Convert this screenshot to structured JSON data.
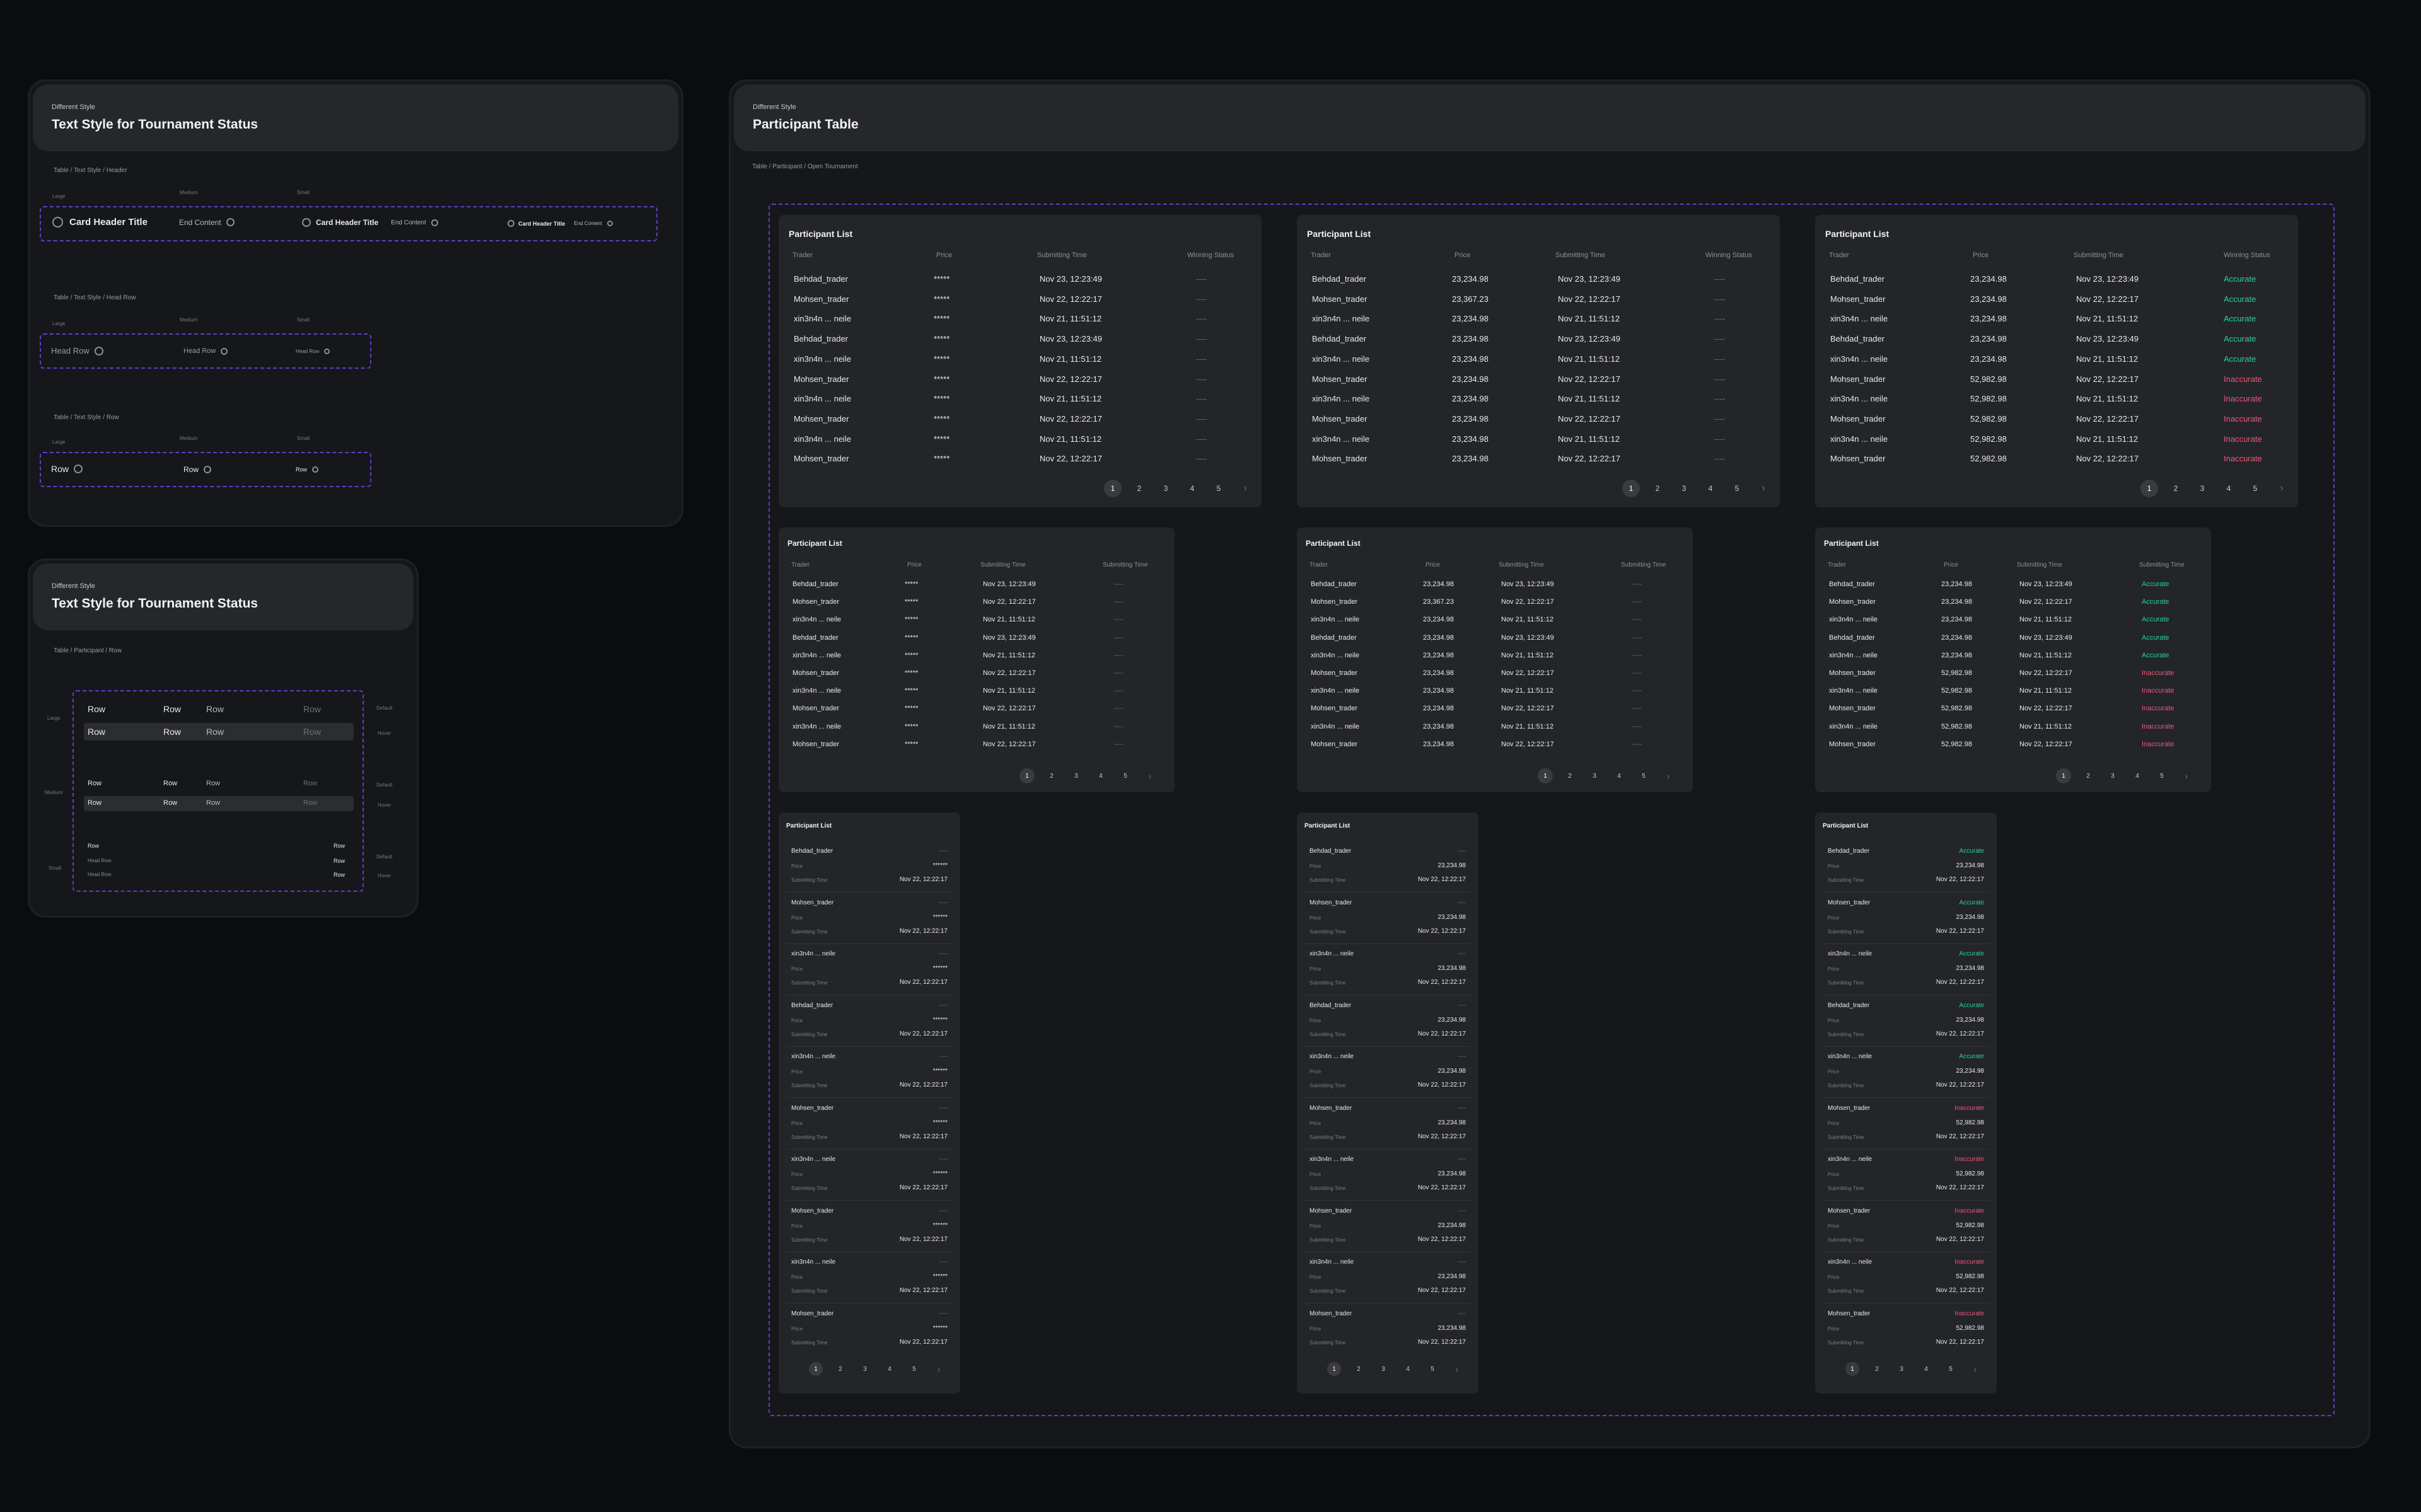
{
  "left_panel_1": {
    "tag": "Different Style",
    "title": "Text Style for Tournament Status",
    "sections": [
      {
        "label": "Table / Text Style / Header"
      },
      {
        "label": "Table / Text Style / Head Row"
      },
      {
        "label": "Table / Text Style / Row"
      }
    ],
    "sizes": {
      "large": "Large",
      "medium": "Medium",
      "small": "Small"
    },
    "header_items": {
      "title": "Card Header Title",
      "end": "End Content"
    },
    "head_row_label": "Head Row",
    "row_label": "Row"
  },
  "left_panel_2": {
    "tag": "Different Style",
    "title": "Text Style for Tournament Status",
    "section": "Table / Participant / Row",
    "size_labels": {
      "large": "Large",
      "medium": "Medium",
      "small": "Small"
    },
    "state_labels": {
      "default": "Default",
      "hover": "Hover"
    },
    "row_label": "Row",
    "head_row_label": "Head Row"
  },
  "right_panel": {
    "tag": "Different Style",
    "title": "Participant Table",
    "breadcrumb": "Table / Participant / Open Tournament"
  },
  "card_title": "Participant List",
  "columns": {
    "trader": "Trader",
    "price": "Price",
    "time": "Submitting Time",
    "status": "Winning Status"
  },
  "col4_medium_label": "Submitting Time",
  "mobile_labels": {
    "price": "Price",
    "time": "Submitting Time"
  },
  "pagination": [
    "1",
    "2",
    "3",
    "4",
    "5"
  ],
  "pagination_next": "›",
  "dash": "----",
  "traders": [
    "Behdad_trader",
    "Mohsen_trader",
    "xin3n4n ... neile",
    "Behdad_trader",
    "xin3n4n ... neile",
    "Mohsen_trader",
    "xin3n4n ... neile",
    "Mohsen_trader",
    "xin3n4n ... neile",
    "Mohsen_trader"
  ],
  "times": [
    "Nov 23, 12:23:49",
    "Nov 22, 12:22:17",
    "Nov 21, 11:51:12",
    "Nov 23, 12:23:49",
    "Nov 21, 11:51:12",
    "Nov 22, 12:22:17",
    "Nov 21, 11:51:12",
    "Nov 22, 12:22:17",
    "Nov 21, 11:51:12",
    "Nov 22, 12:22:17"
  ],
  "masked_price": "*****",
  "prices_pending": [
    "23,234.98",
    "23,367.23",
    "23,234.98",
    "23,234.98",
    "23,234.98",
    "23,234.98",
    "23,234.98",
    "23,234.98",
    "23,234.98",
    "23,234.98"
  ],
  "prices_final": [
    "23,234.98",
    "23,234.98",
    "23,234.98",
    "23,234.98",
    "23,234.98",
    "52,982.98",
    "52,982.98",
    "52,982.98",
    "52,982.98",
    "52,982.98"
  ],
  "statuses": [
    "Accurate",
    "Accurate",
    "Accurate",
    "Accurate",
    "Accurate",
    "Inaccurate",
    "Inaccurate",
    "Inaccurate",
    "Inaccurate",
    "Inaccurate"
  ],
  "mobile_traders": [
    "Behdad_trader",
    "Mohsen_trader",
    "xin3n4n ... neile",
    "Behdad_trader",
    "xin3n4n ... neile",
    "Mohsen_trader",
    "xin3n4n ... neile",
    "Mohsen_trader",
    "xin3n4n ... neile",
    "Mohsen_trader"
  ],
  "mobile_time": "Nov 22, 12:22:17",
  "mobile_masked_price": "******",
  "mobile_prices_pending": [
    "23,234.98",
    "23,234.98",
    "23,234.98",
    "23,234.98",
    "23,234.98",
    "23,234.98",
    "23,234.98",
    "23,234.98",
    "23,234.98",
    "23,234.98"
  ],
  "mobile_prices_final": [
    "23,234.98",
    "23,234.98",
    "23,234.98",
    "23,234.98",
    "23,234.98",
    "52,982.98",
    "52,982.98",
    "52,982.98",
    "52,982.98",
    "52,982.98"
  ],
  "colors": {
    "accurate": "#24d1a3",
    "inaccurate": "#f0557a",
    "dash_border": "#5f3fc4",
    "card": "#242528"
  }
}
